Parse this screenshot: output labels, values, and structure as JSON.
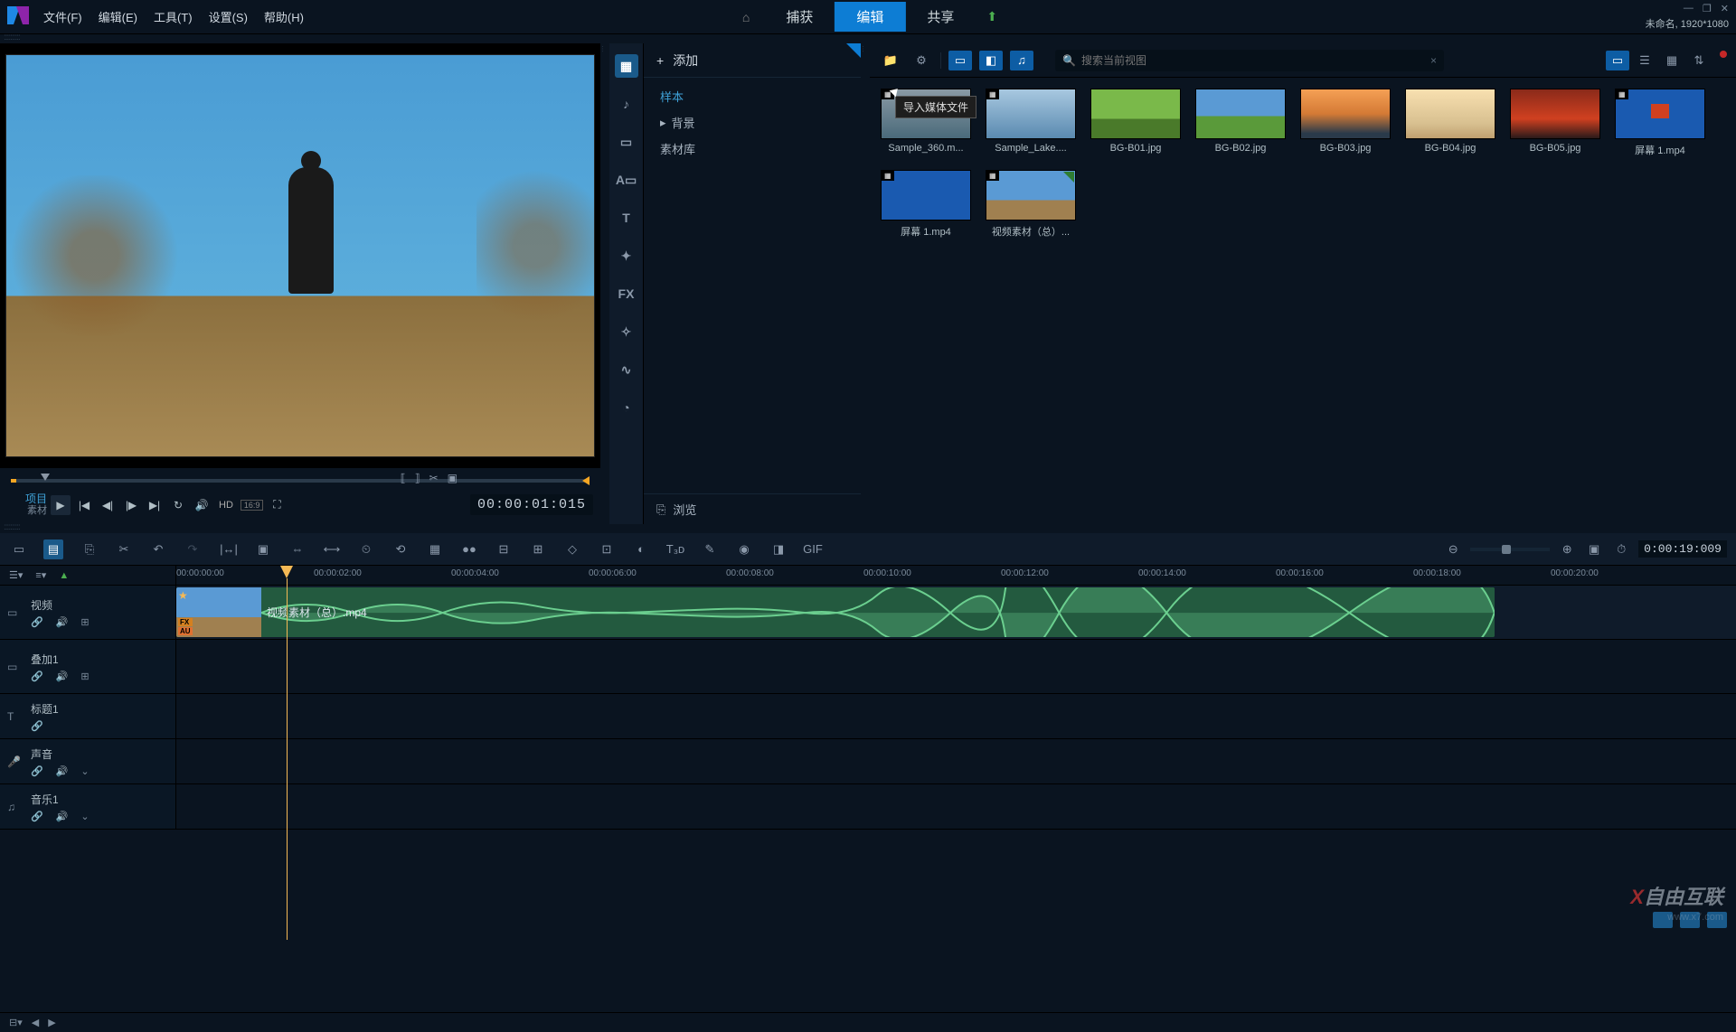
{
  "menu": {
    "file": "文件(F)",
    "edit": "编辑(E)",
    "tool": "工具(T)",
    "settings": "设置(S)",
    "help": "帮助(H)"
  },
  "tabs": {
    "capture": "捕获",
    "edit": "编辑",
    "share": "共享"
  },
  "project_info": "未命名, 1920*1080",
  "preview": {
    "proj_label1": "项目",
    "proj_label2": "素材",
    "hd": "HD",
    "aspect": "16:9",
    "timecode": "00:00:01:015"
  },
  "add_label": "添加",
  "categories": {
    "sample": "样本",
    "bg": "背景",
    "library": "素材库"
  },
  "browse_label": "浏览",
  "search_placeholder": "搜索当前视图",
  "tooltip": "导入媒体文件",
  "thumbs": [
    {
      "label": "Sample_360.m...",
      "cls": "t-sea",
      "badge": "▦"
    },
    {
      "label": "Sample_Lake....",
      "cls": "t-lake",
      "badge": "▦"
    },
    {
      "label": "BG-B01.jpg",
      "cls": "t-green1"
    },
    {
      "label": "BG-B02.jpg",
      "cls": "t-green2"
    },
    {
      "label": "BG-B03.jpg",
      "cls": "t-sunset1"
    },
    {
      "label": "BG-B04.jpg",
      "cls": "t-desert"
    },
    {
      "label": "BG-B05.jpg",
      "cls": "t-red"
    },
    {
      "label": "屏幕 1.mp4",
      "cls": "t-win",
      "badge": "▦"
    },
    {
      "label": "屏幕 1.mp4",
      "cls": "t-blue",
      "badge": "▦"
    },
    {
      "label": "视频素材（总）...",
      "cls": "t-video",
      "badge": "▦",
      "check": true
    }
  ],
  "timeline": {
    "duration": "0:00:19:009",
    "ticks": [
      "00:00:00:00",
      "00:00:02:00",
      "00:00:04:00",
      "00:00:06:00",
      "00:00:08:00",
      "00:00:10:00",
      "00:00:12:00",
      "00:00:14:00",
      "00:00:16:00",
      "00:00:18:00",
      "00:00:20:00"
    ],
    "clip_name": "视频素材（总）.mp4",
    "tracks": {
      "video": "视频",
      "overlay": "叠加1",
      "title": "标题1",
      "voice": "声音",
      "music": "音乐1"
    }
  },
  "watermark": {
    "brand_x": "X",
    "brand_rest": "自由互联",
    "url": "www.x7.com"
  }
}
